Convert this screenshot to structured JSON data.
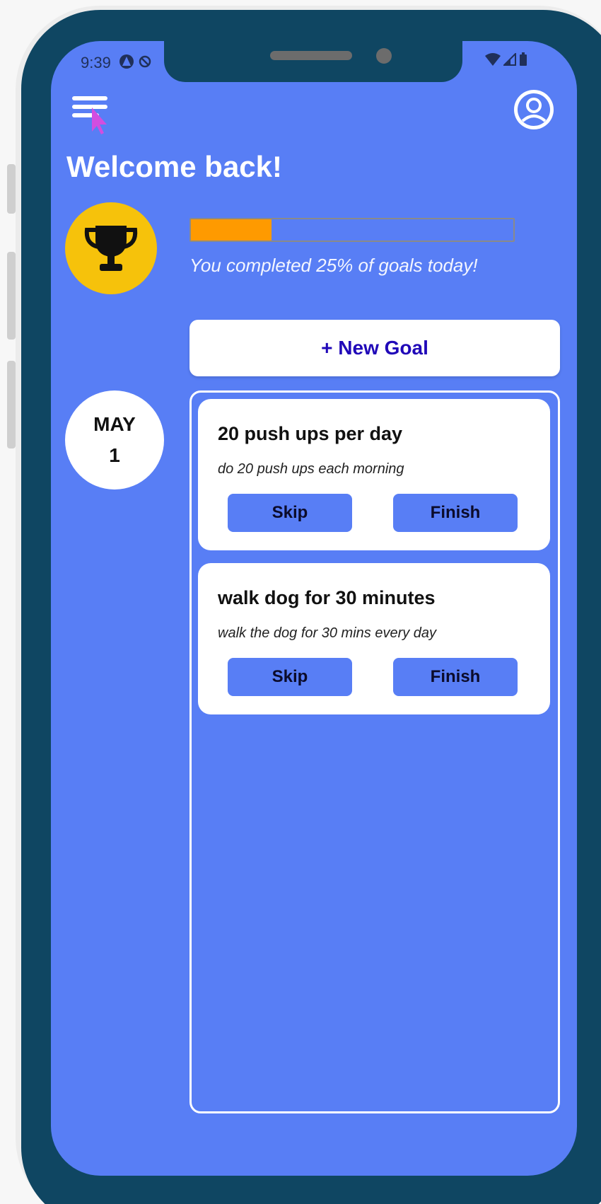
{
  "status_bar": {
    "time": "9:39"
  },
  "header": {
    "title": "Welcome back!",
    "menu_icon": "menu-icon",
    "profile_icon": "account-circle-icon"
  },
  "progress": {
    "percent": 25,
    "text": "You completed 25% of goals today!",
    "fill_color": "#fe9a00"
  },
  "new_goal_button": {
    "label": "+ New Goal"
  },
  "date": {
    "month": "MAY",
    "day": "1"
  },
  "goals": [
    {
      "title": "20 push ups per day",
      "description": "do 20 push ups each morning",
      "skip_label": "Skip",
      "finish_label": "Finish"
    },
    {
      "title": "walk dog for 30 minutes",
      "description": "walk the dog for 30 mins every day",
      "skip_label": "Skip",
      "finish_label": "Finish"
    }
  ],
  "colors": {
    "background": "#587ef5",
    "frame": "#0f4662",
    "trophy_badge": "#f6c20b",
    "accent_text": "#2008b8"
  }
}
